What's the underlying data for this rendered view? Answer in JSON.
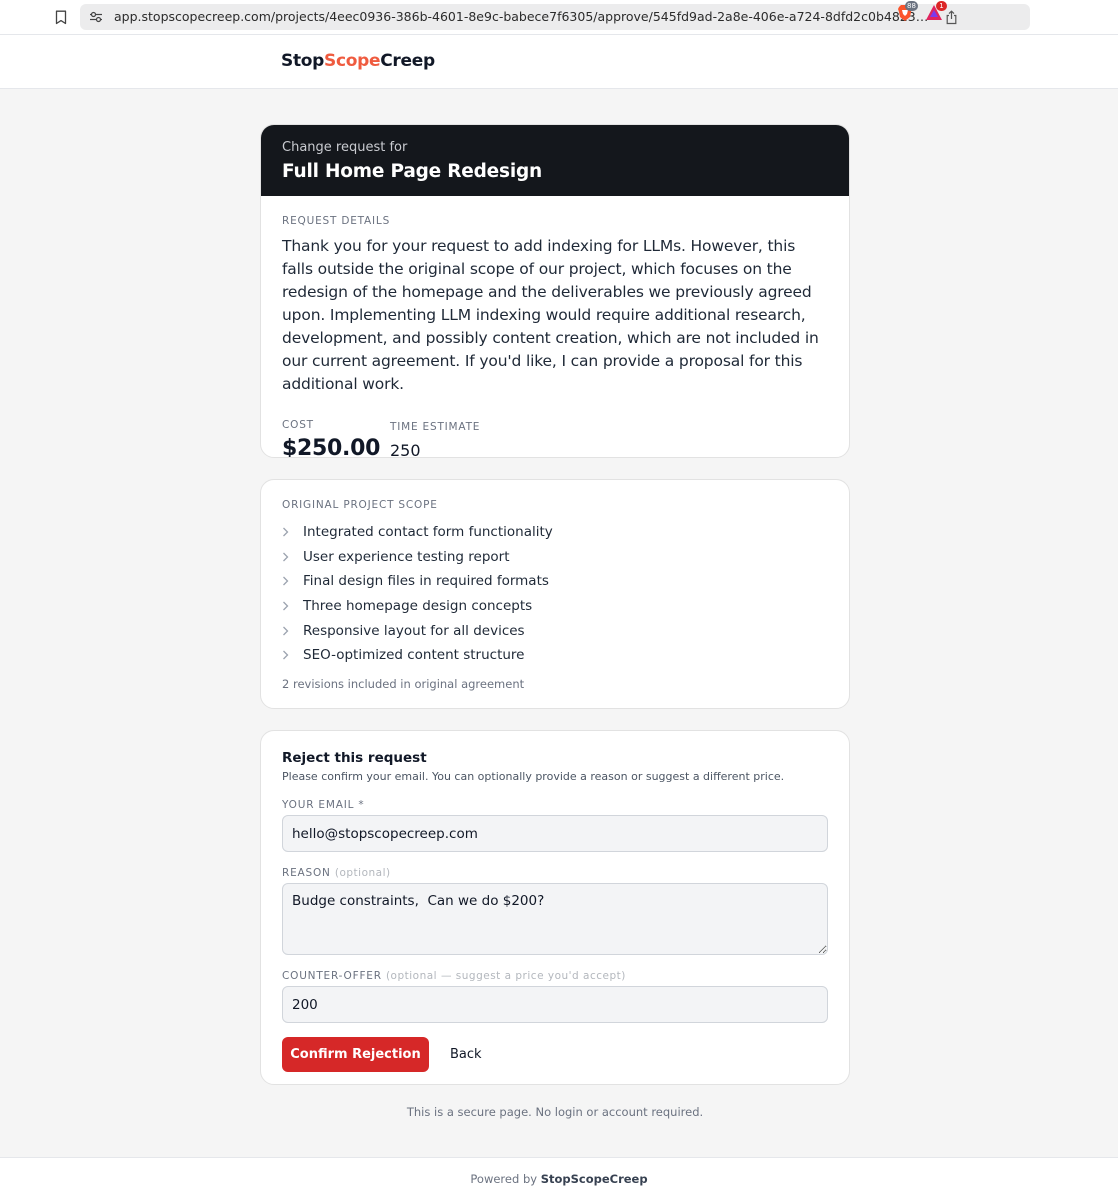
{
  "browser": {
    "url": "app.stopscopecreep.com/projects/4eec0936-386b-4601-8e9c-babece7f6305/approve/545fd9ad-2a8e-406e-a724-8dfd2c0b4823?actio...",
    "ext_badge_count": "88",
    "alert_badge_count": "1",
    "icons": [
      "bookmark-icon",
      "site-info-icon",
      "share-icon",
      "brave-shields-icon",
      "brave-rewards-icon"
    ]
  },
  "header": {
    "logo_part1": "Stop",
    "logo_part2": "Scope",
    "logo_part3": "Creep"
  },
  "request": {
    "subtitle": "Change request for",
    "project_title": "Full Home Page Redesign",
    "details_label": "REQUEST DETAILS",
    "details_text": "Thank you for your request to add indexing for LLMs. However, this falls outside the original scope of our project, which focuses on the redesign of the homepage and the deliverables we previously agreed upon. Implementing LLM indexing would require additional research, development, and possibly content creation, which are not included in our current agreement. If you'd like, I can provide a proposal for this additional work.",
    "cost_label": "COST",
    "cost_value": "$250.00",
    "time_label": "TIME ESTIMATE",
    "time_value": "250"
  },
  "scope": {
    "label": "ORIGINAL PROJECT SCOPE",
    "items": [
      "Integrated contact form functionality",
      "User experience testing report",
      "Final design files in required formats",
      "Three homepage design concepts",
      "Responsive layout for all devices",
      "SEO-optimized content structure"
    ],
    "revisions_note": "2 revisions included in original agreement"
  },
  "reject": {
    "title": "Reject this request",
    "subtitle": "Please confirm your email. You can optionally provide a reason or suggest a different price.",
    "email_label": "YOUR EMAIL *",
    "email_value": "hello@stopscopecreep.com",
    "reason_label": "REASON",
    "reason_optional": "(optional)",
    "reason_value": "Budge constraints,  Can we do $200?",
    "counter_label": "COUNTER-OFFER",
    "counter_optional": "(optional — suggest a price you'd accept)",
    "counter_value": "200",
    "confirm_label": "Confirm Rejection",
    "back_label": "Back"
  },
  "secure_note": "This is a secure page. No login or account required.",
  "footer": {
    "powered_by": "Powered by",
    "brand": "StopScopeCreep"
  },
  "colors": {
    "accent_logo": "#ef5b3f",
    "header_card_bg": "#14171c",
    "danger_button": "#d62828"
  }
}
